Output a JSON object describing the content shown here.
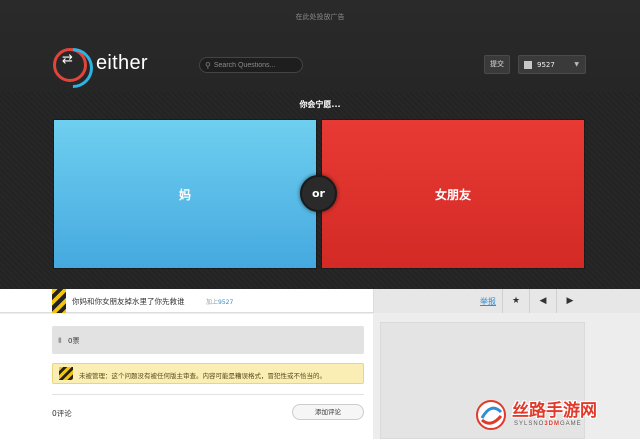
{
  "header": {
    "ad_text": "在此处投放广告",
    "logo_text": "either",
    "search_placeholder": "Search Questions...",
    "submit_label": "提交",
    "user_name": "9527"
  },
  "question": {
    "prompt": "你会宁愿...",
    "option_a": "妈",
    "option_b": "女朋友",
    "or_label": "or",
    "option_a_color": "#5bc0eb",
    "option_b_color": "#e0302b"
  },
  "question_bar": {
    "title": "你妈和你女朋友掉水里了你先救谁",
    "added_by_prefix": "加上",
    "added_by_user": "9527",
    "report_label": "举报"
  },
  "votes": {
    "count_label": "0票"
  },
  "notice": {
    "text": "未被管理：这个问题没有被任何版主审查。内容可能是糟误格式，冒犯性或不恰当的。"
  },
  "comments": {
    "count_label": "0评论",
    "add_label": "添加评论"
  },
  "watermark": {
    "title": "丝路手游网",
    "sub_left": "SYLSNO",
    "sub_mid": "3DM",
    "sub_right": "GAME"
  }
}
